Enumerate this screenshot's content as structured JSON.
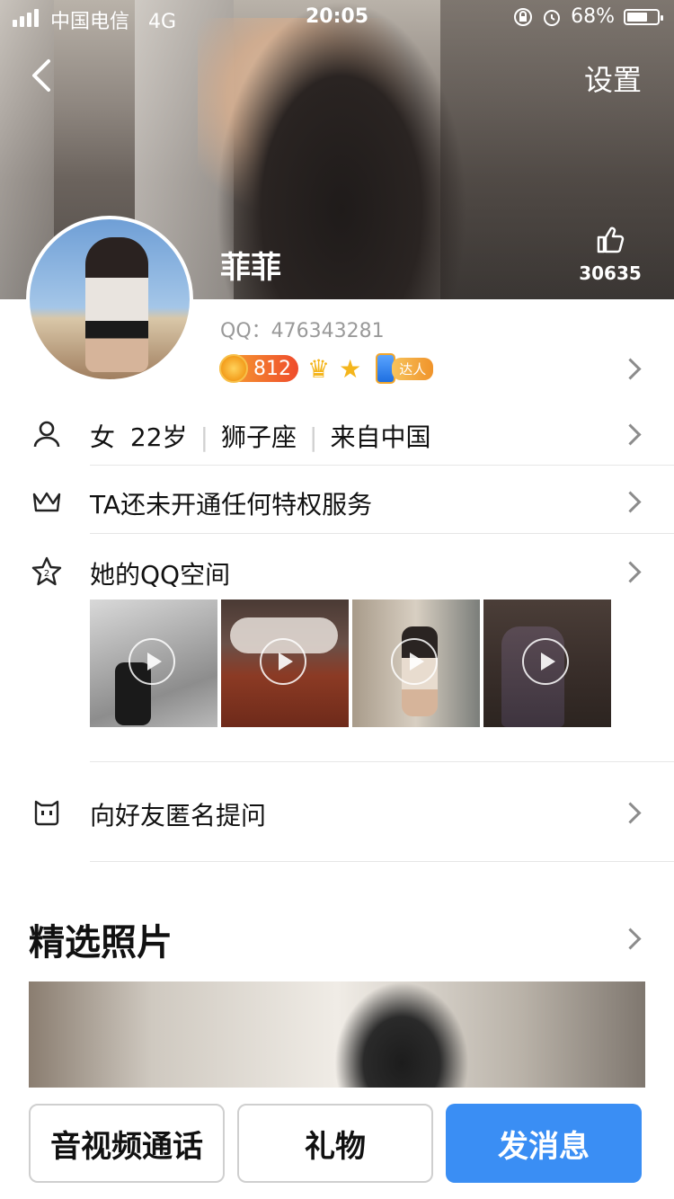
{
  "status_bar": {
    "carrier": "中国电信",
    "network": "4G",
    "time": "20:05",
    "battery": "68%"
  },
  "nav": {
    "settings": "设置"
  },
  "profile": {
    "name": "菲菲",
    "likes": "30635",
    "qq_label": "QQ：",
    "qq_number": "476343281",
    "coin_level": "812",
    "daren_tag": "达人"
  },
  "info": {
    "gender": "女",
    "age": "22岁",
    "zodiac": "狮子座",
    "location": "来自中国",
    "vip_text": "TA还未开通任何特权服务",
    "qzone_title": "她的QQ空间",
    "ask_text": "向好友匿名提问"
  },
  "featured": {
    "title": "精选照片"
  },
  "actions": {
    "call": "音视频通话",
    "gift": "礼物",
    "message": "发消息"
  },
  "colors": {
    "accent": "#3a8ef4"
  }
}
